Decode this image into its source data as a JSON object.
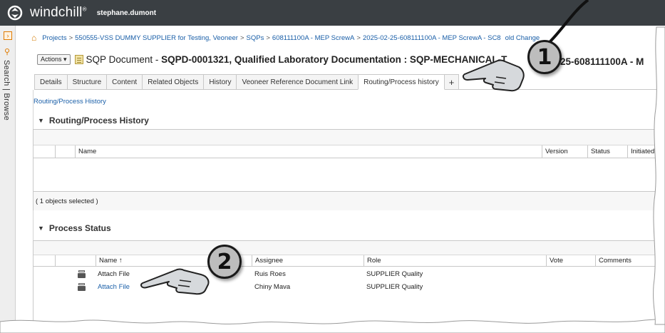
{
  "header": {
    "brand": "windchill",
    "trademark": "®",
    "user": "stephane.dumont"
  },
  "rail": {
    "label": "Search | Browse"
  },
  "breadcrumb": [
    "Projects",
    "550555-VSS DUMMY SUPPLIER for Testing, Veoneer",
    "SQPs",
    "608111100A - MEP ScrewA",
    "2025-02-25-608111100A - MEP ScrewA - SC8",
    "old Change"
  ],
  "title": {
    "actions_label": "Actions ▾",
    "type": "SQP Document - ",
    "name": "SQPD-0001321, Qualified Laboratory Documentation : SQP-MECHANICAL-T",
    "tail": "25-608111100A - M"
  },
  "tabs": [
    {
      "label": "Details"
    },
    {
      "label": "Structure"
    },
    {
      "label": "Content"
    },
    {
      "label": "Related Objects"
    },
    {
      "label": "History"
    },
    {
      "label": "Veoneer Reference Document Link"
    },
    {
      "label": "Routing/Process history",
      "active": true
    },
    {
      "label": "+"
    }
  ],
  "sublink": "Routing/Process History",
  "routing_section": {
    "heading": "Routing/Process History",
    "columns": [
      "Name",
      "Version",
      "Status",
      "Initiated By"
    ],
    "footer": "( 1 objects selected )"
  },
  "process_section": {
    "heading": "Process Status",
    "columns": [
      "Name ↑",
      "Assignee",
      "Role",
      "Vote",
      "Comments"
    ],
    "rows": [
      {
        "name": "Attach File",
        "assignee": "Ruis Roes",
        "role": "SUPPLIER Quality",
        "link": false
      },
      {
        "name": "Attach File",
        "assignee": "Chiny Mava",
        "role": "SUPPLIER Quality",
        "link": true
      }
    ]
  },
  "callouts": {
    "one": "1",
    "two": "2"
  },
  "colors": {
    "header_bg": "#3a3f43",
    "link": "#1a5fa8",
    "accent_orange": "#e07b00",
    "callout_fill": "#bdbdbd"
  }
}
